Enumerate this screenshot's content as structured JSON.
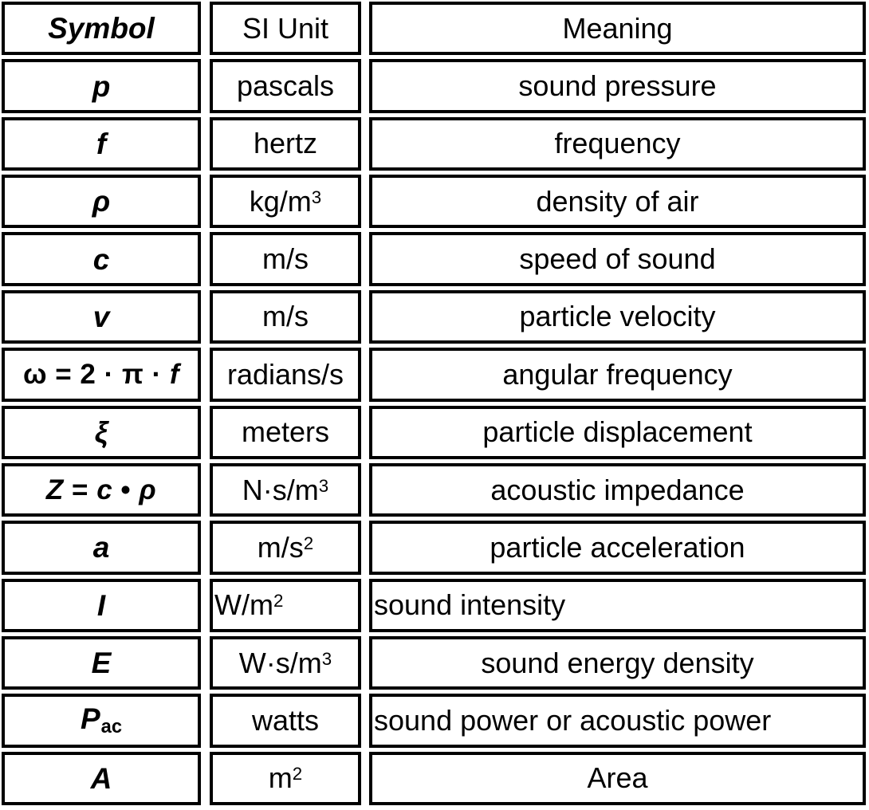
{
  "table": {
    "columns": [
      "Symbol",
      "SI Unit",
      "Meaning"
    ],
    "rows": [
      {
        "symbol": "p",
        "unit": "pascals",
        "meaning": "sound pressure"
      },
      {
        "symbol": "f",
        "unit": "hertz",
        "meaning": "frequency"
      },
      {
        "symbol": "ρ",
        "unit": "kg/m³",
        "meaning": "density of air"
      },
      {
        "symbol": "c",
        "unit": "m/s",
        "meaning": "speed of sound"
      },
      {
        "symbol": "v",
        "unit": "m/s",
        "meaning": "particle velocity"
      },
      {
        "symbol": "ω = 2 · π · f",
        "unit": "radians/s",
        "meaning": "angular frequency"
      },
      {
        "symbol": "ξ",
        "unit": "meters",
        "meaning": "particle displacement"
      },
      {
        "symbol": "Z = c • ρ",
        "unit": "N·s/m³",
        "meaning": "acoustic impedance"
      },
      {
        "symbol": "a",
        "unit": "m/s²",
        "meaning": "particle acceleration"
      },
      {
        "symbol": "I",
        "unit": "W/m²",
        "meaning": "sound intensity"
      },
      {
        "symbol": "E",
        "unit": "W·s/m³",
        "meaning": "sound energy density"
      },
      {
        "symbol": "Pac",
        "unit": "watts",
        "meaning": "sound power or acoustic power"
      },
      {
        "symbol": "A",
        "unit": "m²",
        "meaning": "Area"
      }
    ],
    "symbol_parts": {
      "omega_expr": {
        "omega": "ω",
        "eq": " = ",
        "two": "2",
        "dot1": " · ",
        "pi": "π",
        "dot2": " · ",
        "f": "f"
      },
      "z_expr": {
        "z": "Z",
        "eq": " = ",
        "c": "c",
        "dot": " • ",
        "rho": "ρ"
      },
      "p_ac": {
        "base": "P",
        "subscript": "ac"
      }
    },
    "units_parts": {
      "kg_m3": {
        "base": "kg/m",
        "exp": "3"
      },
      "n_s_m3": {
        "base": "N·s/m",
        "exp": "3"
      },
      "m_s2": {
        "base": "m/s",
        "exp": "2"
      },
      "w_m2": {
        "base": "W/m",
        "exp": "2"
      },
      "w_s_m3": {
        "base": "W·s/m",
        "exp": "3"
      },
      "m2": {
        "base": "m",
        "exp": "2"
      }
    },
    "colors": {
      "border": "#000000",
      "background": "#ffffff",
      "text": "#000000"
    }
  }
}
